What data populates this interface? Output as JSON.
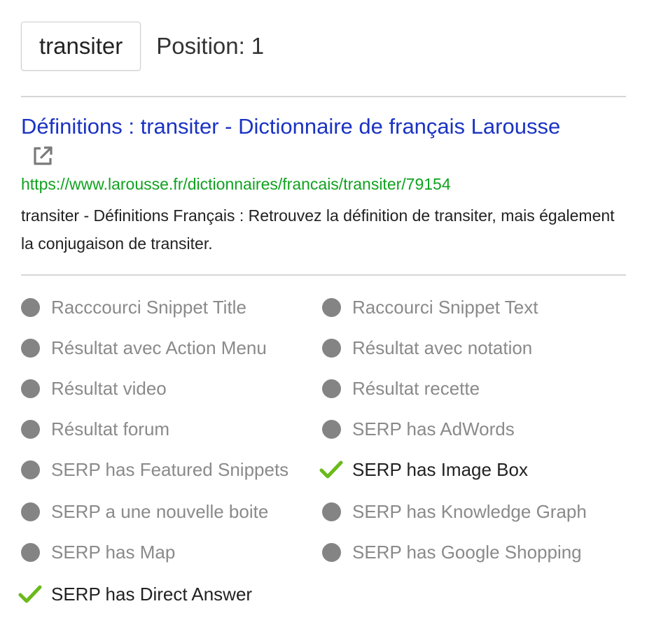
{
  "keyword": "transiter",
  "position": {
    "label": "Position:",
    "value": "1"
  },
  "result": {
    "title": "Définitions : transiter - Dictionnaire de français Larousse",
    "url": "https://www.larousse.fr/dictionnaires/francais/transiter/79154",
    "description": "transiter - Définitions Français : Retrouvez la définition de transiter, mais également la conjugaison de transiter."
  },
  "features": [
    {
      "label": "Racccourci Snippet Title",
      "present": false
    },
    {
      "label": "Raccourci Snippet Text",
      "present": false
    },
    {
      "label": "Résultat avec Action Menu",
      "present": false
    },
    {
      "label": "Résultat avec notation",
      "present": false
    },
    {
      "label": "Résultat video",
      "present": false
    },
    {
      "label": "Résultat recette",
      "present": false
    },
    {
      "label": "Résultat forum",
      "present": false
    },
    {
      "label": "SERP has AdWords",
      "present": false
    },
    {
      "label": "SERP has Featured Snippets",
      "present": false
    },
    {
      "label": "SERP has Image Box",
      "present": true
    },
    {
      "label": "SERP a une nouvelle boite",
      "present": false
    },
    {
      "label": "SERP has Knowledge Graph",
      "present": false
    },
    {
      "label": "SERP has Map",
      "present": false
    },
    {
      "label": "SERP has Google Shopping",
      "present": false
    },
    {
      "label": "SERP has Direct Answer",
      "present": true
    }
  ],
  "icons": {
    "external_link": "external-link-icon",
    "check": "check-icon",
    "absent": "dot-icon"
  },
  "colors": {
    "title_link": "#1a33c4",
    "url": "#10a21f",
    "check": "#6aba1a",
    "dot": "#848484",
    "inactive_text": "#8a8a8a"
  }
}
